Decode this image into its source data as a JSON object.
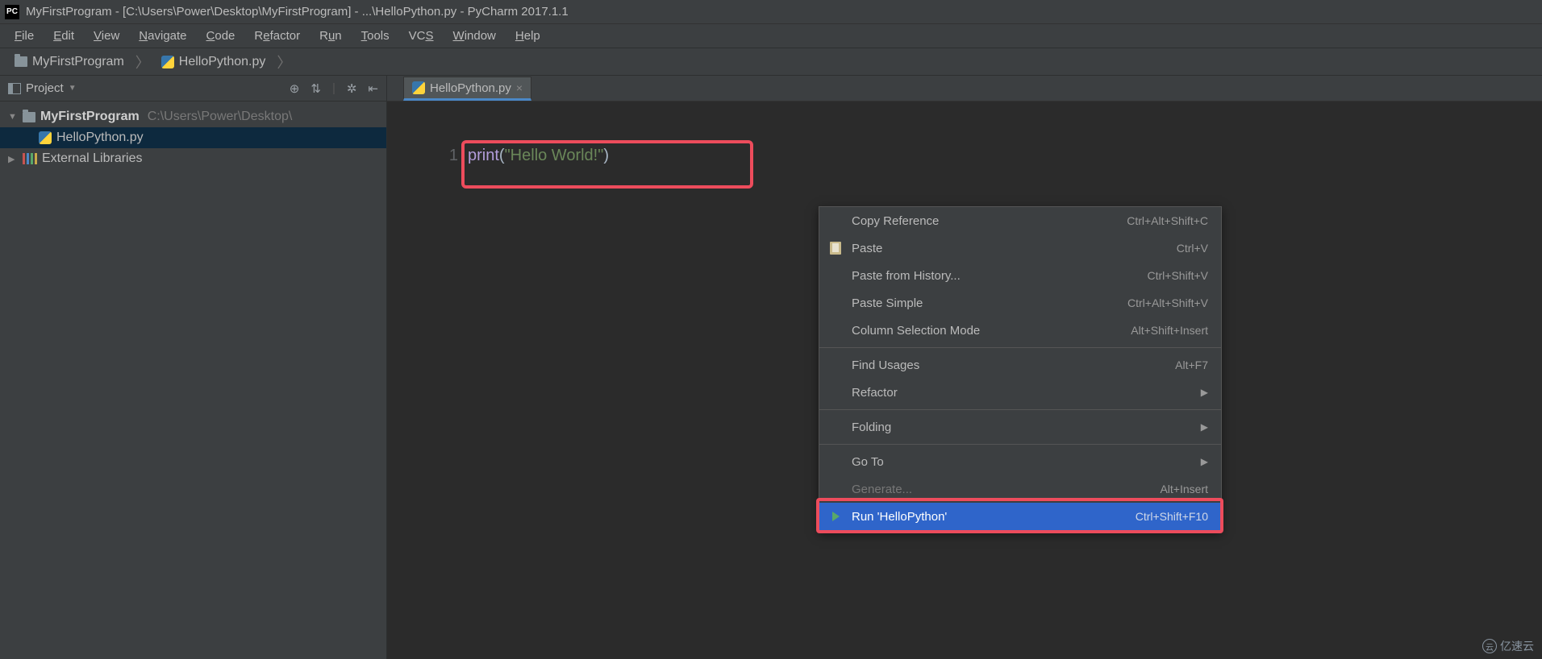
{
  "titlebar": {
    "app_icon_text": "PC",
    "title": "MyFirstProgram - [C:\\Users\\Power\\Desktop\\MyFirstProgram] - ...\\HelloPython.py - PyCharm 2017.1.1"
  },
  "menubar": {
    "items": [
      "File",
      "Edit",
      "View",
      "Navigate",
      "Code",
      "Refactor",
      "Run",
      "Tools",
      "VCS",
      "Window",
      "Help"
    ],
    "underline_idx": [
      0,
      0,
      0,
      0,
      0,
      1,
      1,
      0,
      2,
      0,
      0
    ]
  },
  "breadcrumb": {
    "items": [
      "MyFirstProgram",
      "HelloPython.py"
    ]
  },
  "sidebar": {
    "header_title": "Project",
    "tree": {
      "root_name": "MyFirstProgram",
      "root_path": "C:\\Users\\Power\\Desktop\\",
      "file_name": "HelloPython.py",
      "ext_lib": "External Libraries"
    }
  },
  "editor": {
    "tab_label": "HelloPython.py",
    "line_number": "1",
    "code": {
      "fn": "print",
      "open": "(",
      "str": "\"Hello World!\"",
      "close": ")"
    }
  },
  "context_menu": {
    "items": [
      {
        "label": "Copy Reference",
        "shortcut": "Ctrl+Alt+Shift+C",
        "icon": ""
      },
      {
        "label": "Paste",
        "shortcut": "Ctrl+V",
        "icon": "paste"
      },
      {
        "label": "Paste from History...",
        "shortcut": "Ctrl+Shift+V",
        "icon": ""
      },
      {
        "label": "Paste Simple",
        "shortcut": "Ctrl+Alt+Shift+V",
        "icon": ""
      },
      {
        "label": "Column Selection Mode",
        "shortcut": "Alt+Shift+Insert",
        "icon": ""
      },
      {
        "sep": true
      },
      {
        "label": "Find Usages",
        "shortcut": "Alt+F7",
        "icon": ""
      },
      {
        "label": "Refactor",
        "submenu": true,
        "icon": ""
      },
      {
        "sep": true
      },
      {
        "label": "Folding",
        "submenu": true,
        "icon": ""
      },
      {
        "sep": true
      },
      {
        "label": "Go To",
        "submenu": true,
        "icon": ""
      },
      {
        "label": "Generate...",
        "shortcut": "Alt+Insert",
        "icon": "",
        "disabled": true
      },
      {
        "label": "Run 'HelloPython'",
        "shortcut": "Ctrl+Shift+F10",
        "icon": "play",
        "highlighted": true
      }
    ]
  },
  "watermark": "亿速云"
}
